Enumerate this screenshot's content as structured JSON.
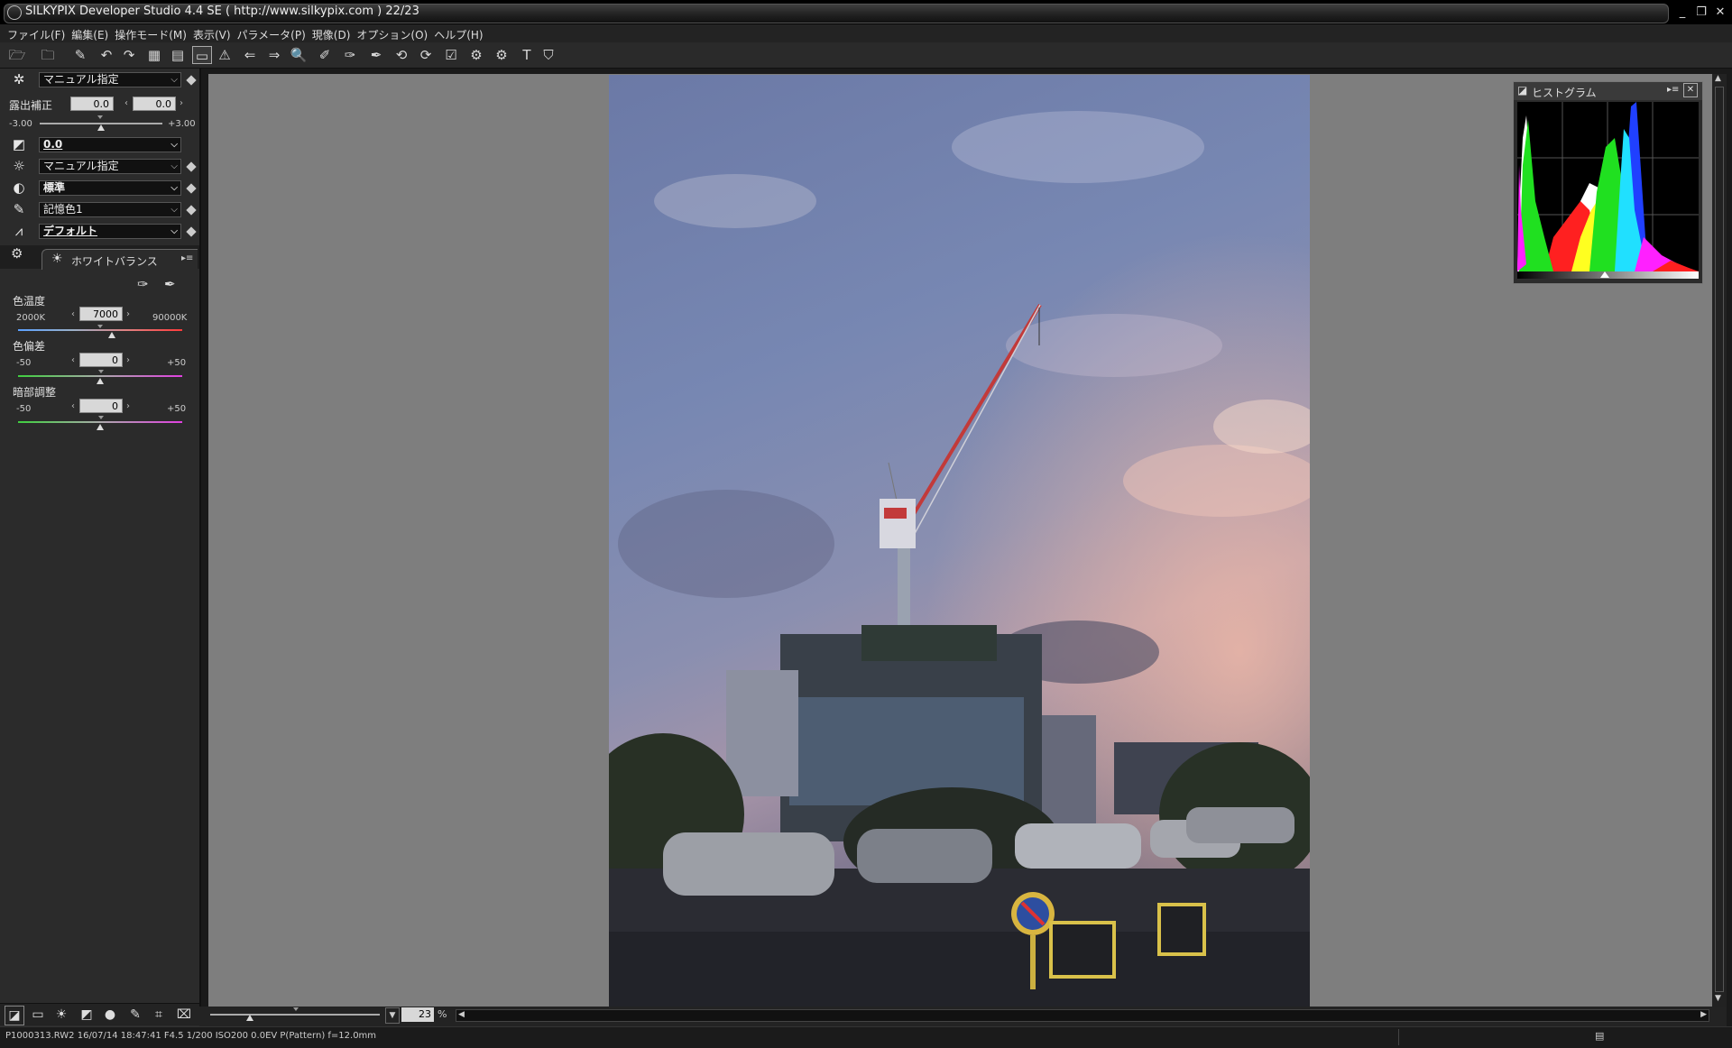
{
  "window": {
    "title": "SILKYPIX Developer Studio 4.4 SE ( http://www.silkypix.com )   22/23",
    "minimize": "_",
    "restore": "❐",
    "close": "✕"
  },
  "menu": [
    "ファイル(F)",
    "編集(E)",
    "操作モード(M)",
    "表示(V)",
    "パラメータ(P)",
    "現像(D)",
    "オプション(O)",
    "ヘルプ(H)"
  ],
  "toolbar_icons": [
    "open-folder-icon",
    "browse-folder-icon",
    "eraser-icon",
    "undo-icon",
    "redo-icon",
    "grid-view-icon",
    "filmstrip-view-icon",
    "single-view-icon",
    "warning-icon",
    "prev-icon",
    "next-icon",
    "zoom-icon",
    "eyedropper-icon",
    "eyedropper-fill-icon",
    "gray-picker-icon",
    "rotate-left-icon",
    "rotate-right-icon",
    "check-icon",
    "develop-icon",
    "develop-all-icon",
    "text-tool-icon",
    "shield-icon"
  ],
  "panel": {
    "preset": "マニュアル指定",
    "exposure": {
      "label": "露出補正",
      "value1": "0.0",
      "value2": "0.0",
      "min": "-3.00",
      "max": "+3.00"
    },
    "tone": "0.0",
    "color_preset": "マニュアル指定",
    "contrast": "標準",
    "color": "記憶色1",
    "sharpness": "デフォルト",
    "wb_tab": "ホワイトバランス",
    "color_temp": {
      "label": "色温度",
      "value": "7000",
      "min": "2000K",
      "max": "90000K",
      "level": 0.57
    },
    "tint": {
      "label": "色偏差",
      "value": "0",
      "min": "-50",
      "max": "+50",
      "level": 0.5
    },
    "dark_adjust": {
      "label": "暗部調整",
      "value": "0",
      "min": "-50",
      "max": "+50",
      "level": 0.5
    }
  },
  "histogram": {
    "title": "ヒストグラム",
    "menu": "▸≡",
    "close": "✕"
  },
  "zoom": {
    "value": "23",
    "unit": "%"
  },
  "status": "P1000313.RW2  16/07/14  18:47:41  F4.5  1/200  ISO200   0.0EV  P(Pattern)  f=12.0mm"
}
